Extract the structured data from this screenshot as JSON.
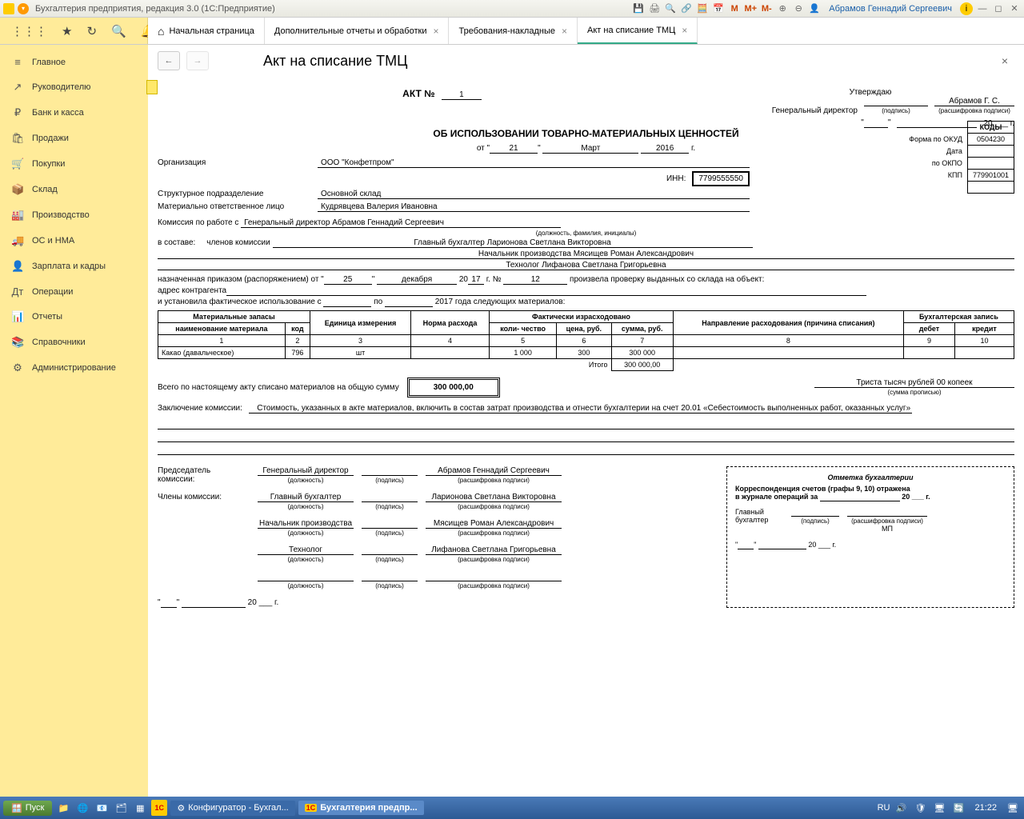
{
  "titlebar": {
    "title": "Бухгалтерия предприятия, редакция 3.0  (1С:Предприятие)",
    "user": "Абрамов Геннадий Сергеевич"
  },
  "tabs": {
    "home": "Начальная страница",
    "t1": "Дополнительные отчеты и обработки",
    "t2": "Требования-накладные",
    "t3": "Акт на списание ТМЦ"
  },
  "sidebar": {
    "items": [
      {
        "icon": "≡",
        "label": "Главное"
      },
      {
        "icon": "↗",
        "label": "Руководителю"
      },
      {
        "icon": "₽",
        "label": "Банк и касса"
      },
      {
        "icon": "🛍",
        "label": "Продажи"
      },
      {
        "icon": "🛒",
        "label": "Покупки"
      },
      {
        "icon": "📦",
        "label": "Склад"
      },
      {
        "icon": "🏭",
        "label": "Производство"
      },
      {
        "icon": "🚚",
        "label": "ОС и НМА"
      },
      {
        "icon": "👤",
        "label": "Зарплата и кадры"
      },
      {
        "icon": "Дт",
        "label": "Операции"
      },
      {
        "icon": "📊",
        "label": "Отчеты"
      },
      {
        "icon": "📚",
        "label": "Справочники"
      },
      {
        "icon": "⚙",
        "label": "Администрирование"
      }
    ]
  },
  "page": {
    "title": "Акт на списание ТМЦ"
  },
  "doc": {
    "approve": "Утверждаю",
    "director_label": "Генеральный директор",
    "director_name": "Абрамов Г. С.",
    "sign_hint": "(подпись)",
    "decode_hint": "(расшифровка подписи)",
    "year_suffix": "20 ___ г.",
    "act_no_label": "АКТ №",
    "act_no": "1",
    "act_title": "ОБ ИСПОЛЬЗОВАНИИ ТОВАРНО-МАТЕРИАЛЬНЫХ ЦЕННОСТЕЙ",
    "date_from": "от",
    "day": "21",
    "month": "Март",
    "year": "2016",
    "year_g": "г.",
    "org_label": "Организация",
    "org": "ООО \"Конфетпром\"",
    "struct_label": "Структурное подразделение",
    "struct": "Основной склад",
    "resp_label": "Материально ответственное лицо",
    "resp": "Кудрявцева Валерия Ивановна",
    "inn_label": "ИНН:",
    "inn": "7799555550",
    "codes_header": "КОДЫ",
    "okud_label": "Форма по ОКУД",
    "okud": "0504230",
    "date_label": "Дата",
    "okpo_label": "по ОКПО",
    "kpp_label": "КПП",
    "kpp": "779901001",
    "comm_intro": "Комиссия по работе с",
    "comm_head": "Генеральный директор  Абрамов Геннадий Сергеевич",
    "comm_hint": "(должность, фамилия, инициалы)",
    "comm_in": "в составе:",
    "comm_members_label": "членов комиссии",
    "members": [
      "Главный бухгалтер  Ларионова Светлана Викторовна",
      "Начальник производства  Мясищев Роман Александрович",
      "Технолог  Лифанова Светлана Григорьевна"
    ],
    "order_label": "назначенная приказом (распоряжением) от",
    "order_day": "25",
    "order_month": "декабря",
    "order_y_prefix": "20",
    "order_y": "17",
    "order_no_label": "г.  №",
    "order_no": "12",
    "order_tail": "произвела проверку выданных со склада на объект:",
    "addr_label": "адрес контрагента",
    "fact_label": "и установила фактическое использование с",
    "fact_to": "по",
    "fact_year": "2017 года следующих материалов:",
    "tbl": {
      "h_mat": "Материальные запасы",
      "h_name": "наименование материала",
      "h_code": "код",
      "h_unit": "Единица измерения",
      "h_norm": "Норма расхода",
      "h_fact": "Фактически израсходовано",
      "h_qty": "коли-\nчество",
      "h_price": "цена, руб.",
      "h_sum": "сумма, руб.",
      "h_dir": "Направление расходования (причина списания)",
      "h_acc": "Бухгалтерская запись",
      "h_debit": "дебет",
      "h_credit": "кредит",
      "cols": [
        "1",
        "2",
        "3",
        "4",
        "5",
        "6",
        "7",
        "8",
        "9",
        "10"
      ],
      "row": {
        "name": "Какао (давальческое)",
        "code": "796",
        "unit": "шт",
        "norm": "",
        "qty": "1 000",
        "price": "300",
        "sum": "300 000",
        "dir": "",
        "debit": "",
        "credit": ""
      },
      "total_label": "Итого",
      "total": "300 000,00"
    },
    "all_label": "Всего по настоящему акту списано материалов на общую сумму",
    "all_sum": "300 000,00",
    "all_words": "Триста тысяч рублей 00 копеек",
    "words_hint": "(сумма прописью)",
    "concl_label": "Заключение комиссии:",
    "concl": "Стоимость, указанных в акте материалов, включить в состав затрат производства и отнести бухгалтерии на счет 20.01 «Себестоимость выполненных работ, оказанных услуг»",
    "sign": {
      "chair_label": "Председатель комиссии:",
      "members_label": "Члены комиссии:",
      "pos_hint": "(должность)",
      "rows": [
        {
          "pos": "Генеральный директор",
          "name": "Абрамов Геннадий Сергеевич"
        },
        {
          "pos": "Главный бухгалтер",
          "name": "Ларионова Светлана Викторовна"
        },
        {
          "pos": "Начальник производства",
          "name": "Мясищев Роман Александрович"
        },
        {
          "pos": "Технолог",
          "name": "Лифанова Светлана Григорьевна"
        }
      ]
    },
    "acc": {
      "title": "Отметка бухгалтерии",
      "line1a": "Корреспонденция счетов (графы 9, 10) отражена",
      "line1b": "в журнале операций за",
      "main_acc": "Главный бухгалтер",
      "mp": "МП"
    }
  },
  "taskbar": {
    "start": "Пуск",
    "btn1": "Конфигуратор - Бухгал...",
    "btn2": "Бухгалтерия предпр...",
    "lang": "RU",
    "time": "21:22"
  }
}
